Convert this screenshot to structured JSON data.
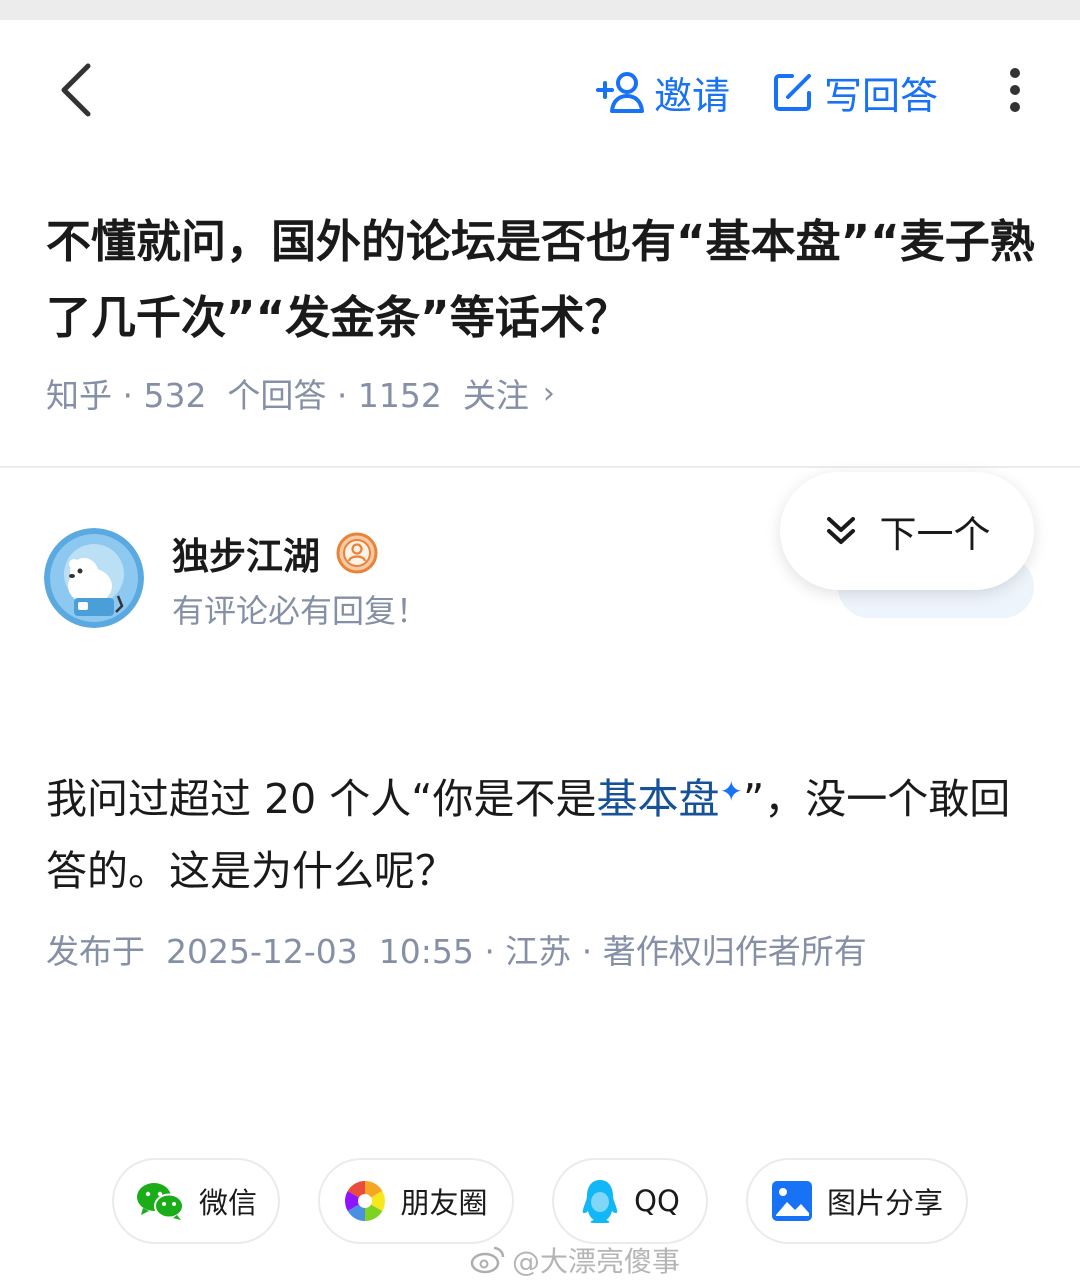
{
  "header": {
    "invite_label": "邀请",
    "write_answer_label": "写回答"
  },
  "question": {
    "title": "不懂就问，国外的论坛是否也有“基本盘”“麦子熟了几千次”“发金条”等话术？",
    "meta": "知乎 · 532  个回答 · 1152  关注"
  },
  "next_button": {
    "label": "下一个"
  },
  "author": {
    "name": "独步江湖",
    "bio": "有评论必有回复！"
  },
  "answer": {
    "text_before": "我问过超过 20 个人“你是不是",
    "keyword": "基本盘",
    "text_after": "”，没一个敢回答的。这是为什么呢？",
    "published": "发布于  2025-12-03  10:55 · 江苏 · 著作权归作者所有"
  },
  "share": {
    "wechat": "微信",
    "moments": "朋友圈",
    "qq": "QQ",
    "image_share": "图片分享"
  },
  "watermark": "@大漂亮傻事",
  "colors": {
    "accent": "#1772f6",
    "keyword": "#175199",
    "muted": "#8590a6",
    "badge": "#e8833a"
  }
}
